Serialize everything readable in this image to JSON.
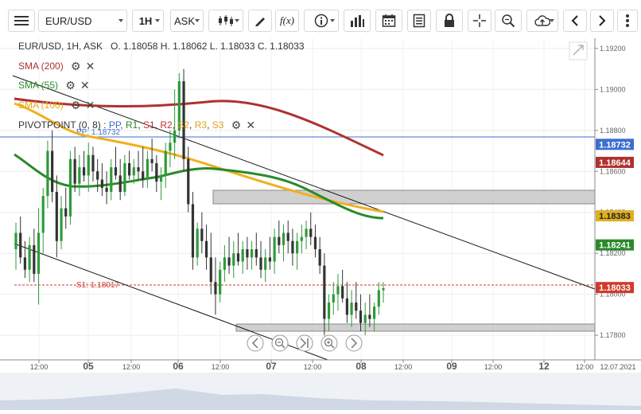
{
  "toolbar": {
    "symbol": "EUR/USD",
    "timeframe": "1H",
    "price_side": "ASK",
    "fx_label": "f(x)"
  },
  "info": {
    "header": "EUR/USD, 1H, ASK   O. 1.18058 H. 1.18062 L. 1.18033 C. 1.18033"
  },
  "indicators": {
    "sma200": {
      "label": "SMA (200)",
      "color": "#b03030"
    },
    "sma55": {
      "label": "SMA (55)",
      "color": "#2a8a2a"
    },
    "sma100": {
      "label": "SMA (100)",
      "color": "#f0b020"
    },
    "pivot": {
      "label": "PIVOTPOINT (0, 8)",
      "parts": [
        {
          "text": "PP",
          "color": "#3b6fd0"
        },
        {
          "text": "R1",
          "color": "#2a8a2a"
        },
        {
          "text": "S1",
          "color": "#c03030"
        },
        {
          "text": "R2",
          "color": "#c03030"
        },
        {
          "text": "S2",
          "color": "#e0a020"
        },
        {
          "text": "R3",
          "color": "#e0a020"
        },
        {
          "text": "S3",
          "color": "#e0a020"
        }
      ],
      "pp_label": "PP: 1.18732",
      "s1_label": "S1: 1.18017"
    }
  },
  "price_axis": {
    "ticks": [
      "1.19200",
      "1.19000",
      "1.18800",
      "1.18600",
      "1.18400",
      "1.18200",
      "1.18000",
      "1.17800"
    ],
    "badges": [
      {
        "value": "1.18732",
        "color": "#3b6fd0"
      },
      {
        "value": "1.18644",
        "color": "#b03030"
      },
      {
        "value": "1.18383",
        "color": "#e0b020"
      },
      {
        "value": "1.18241",
        "color": "#2a8a2a"
      },
      {
        "value": "1.18033",
        "color": "#d03a2a"
      }
    ]
  },
  "time_axis": {
    "labels": [
      "12:00",
      "05",
      "12:00",
      "06",
      "12:00",
      "07",
      "12:00",
      "08",
      "12:00",
      "09",
      "12:00",
      "12",
      "12:00",
      "12.07.2021"
    ]
  },
  "chart_data": {
    "type": "candlestick",
    "y_range": [
      1.1768,
      1.1925
    ],
    "candles": [
      [
        1.1822,
        1.1835,
        1.1812,
        1.183
      ],
      [
        1.183,
        1.1838,
        1.1815,
        1.1818
      ],
      [
        1.1818,
        1.1826,
        1.1808,
        1.1812
      ],
      [
        1.1812,
        1.1828,
        1.1806,
        1.1824
      ],
      [
        1.1824,
        1.1832,
        1.1806,
        1.181
      ],
      [
        1.181,
        1.1842,
        1.1795,
        1.183
      ],
      [
        1.183,
        1.1852,
        1.182,
        1.1848
      ],
      [
        1.1848,
        1.1875,
        1.1842,
        1.187
      ],
      [
        1.187,
        1.188,
        1.1845,
        1.185
      ],
      [
        1.185,
        1.1858,
        1.1818,
        1.1826
      ],
      [
        1.1826,
        1.1848,
        1.1822,
        1.1842
      ],
      [
        1.1842,
        1.1852,
        1.1832,
        1.1838
      ],
      [
        1.1838,
        1.187,
        1.1834,
        1.1866
      ],
      [
        1.1866,
        1.1872,
        1.185,
        1.1854
      ],
      [
        1.1854,
        1.1868,
        1.1848,
        1.1862
      ],
      [
        1.1862,
        1.187,
        1.1855,
        1.1858
      ],
      [
        1.1858,
        1.1874,
        1.185,
        1.1868
      ],
      [
        1.1868,
        1.1872,
        1.1855,
        1.186
      ],
      [
        1.186,
        1.1866,
        1.185,
        1.1856
      ],
      [
        1.1856,
        1.1864,
        1.1848,
        1.1852
      ],
      [
        1.1852,
        1.186,
        1.1844,
        1.185
      ],
      [
        1.185,
        1.1866,
        1.1846,
        1.1862
      ],
      [
        1.1862,
        1.1872,
        1.1856,
        1.1858
      ],
      [
        1.1858,
        1.1866,
        1.1846,
        1.185
      ],
      [
        1.185,
        1.1868,
        1.1848,
        1.1864
      ],
      [
        1.1864,
        1.187,
        1.1856,
        1.1858
      ],
      [
        1.1858,
        1.1866,
        1.1854,
        1.1862
      ],
      [
        1.1862,
        1.187,
        1.1856,
        1.186
      ],
      [
        1.186,
        1.1872,
        1.1852,
        1.1856
      ],
      [
        1.1856,
        1.187,
        1.1852,
        1.1866
      ],
      [
        1.1866,
        1.1876,
        1.186,
        1.1864
      ],
      [
        1.1864,
        1.1868,
        1.185,
        1.1855
      ],
      [
        1.1855,
        1.1862,
        1.1846,
        1.1858
      ],
      [
        1.1858,
        1.1874,
        1.1852,
        1.187
      ],
      [
        1.187,
        1.188,
        1.1862,
        1.1874
      ],
      [
        1.1874,
        1.19,
        1.1866,
        1.188
      ],
      [
        1.188,
        1.1908,
        1.1876,
        1.1904
      ],
      [
        1.1904,
        1.191,
        1.186,
        1.1866
      ],
      [
        1.1866,
        1.1872,
        1.184,
        1.1844
      ],
      [
        1.1844,
        1.185,
        1.1812,
        1.1818
      ],
      [
        1.1818,
        1.1835,
        1.1814,
        1.1832
      ],
      [
        1.1832,
        1.184,
        1.182,
        1.1826
      ],
      [
        1.1826,
        1.1834,
        1.1812,
        1.1818
      ],
      [
        1.1818,
        1.183,
        1.18,
        1.1806
      ],
      [
        1.1806,
        1.1818,
        1.179,
        1.18
      ],
      [
        1.18,
        1.1816,
        1.1796,
        1.1812
      ],
      [
        1.1812,
        1.1824,
        1.1806,
        1.1818
      ],
      [
        1.1818,
        1.1828,
        1.181,
        1.1814
      ],
      [
        1.1814,
        1.1826,
        1.1808,
        1.182
      ],
      [
        1.182,
        1.183,
        1.1814,
        1.1816
      ],
      [
        1.1816,
        1.1826,
        1.181,
        1.1822
      ],
      [
        1.1822,
        1.1828,
        1.1812,
        1.1818
      ],
      [
        1.1818,
        1.1826,
        1.1812,
        1.1822
      ],
      [
        1.1822,
        1.183,
        1.1814,
        1.1818
      ],
      [
        1.1818,
        1.1826,
        1.1808,
        1.1812
      ],
      [
        1.1812,
        1.1822,
        1.1806,
        1.1818
      ],
      [
        1.1818,
        1.1828,
        1.1812,
        1.1816
      ],
      [
        1.1816,
        1.1832,
        1.181,
        1.1828
      ],
      [
        1.1828,
        1.1836,
        1.182,
        1.1824
      ],
      [
        1.1824,
        1.1834,
        1.1816,
        1.183
      ],
      [
        1.183,
        1.1836,
        1.182,
        1.1826
      ],
      [
        1.1826,
        1.1832,
        1.1814,
        1.182
      ],
      [
        1.182,
        1.183,
        1.1812,
        1.1826
      ],
      [
        1.1826,
        1.1834,
        1.182,
        1.1828
      ],
      [
        1.1828,
        1.1836,
        1.1822,
        1.1832
      ],
      [
        1.1832,
        1.184,
        1.1824,
        1.1828
      ],
      [
        1.1828,
        1.1834,
        1.1818,
        1.1822
      ],
      [
        1.1822,
        1.1828,
        1.181,
        1.1814
      ],
      [
        1.1814,
        1.182,
        1.178,
        1.1788
      ],
      [
        1.1788,
        1.18,
        1.1782,
        1.1796
      ],
      [
        1.1796,
        1.1806,
        1.179,
        1.18
      ],
      [
        1.18,
        1.181,
        1.1792,
        1.1804
      ],
      [
        1.1804,
        1.1812,
        1.1796,
        1.1798
      ],
      [
        1.1798,
        1.1806,
        1.1786,
        1.179
      ],
      [
        1.179,
        1.1802,
        1.1784,
        1.1796
      ],
      [
        1.1796,
        1.1806,
        1.1788,
        1.1792
      ],
      [
        1.1792,
        1.18,
        1.1782,
        1.1786
      ],
      [
        1.1786,
        1.1796,
        1.178,
        1.179
      ],
      [
        1.179,
        1.18,
        1.1784,
        1.1788
      ],
      [
        1.1788,
        1.1796,
        1.1782,
        1.1794
      ],
      [
        1.1794,
        1.1806,
        1.179,
        1.1802
      ],
      [
        1.1802,
        1.1806,
        1.1796,
        1.1803
      ]
    ],
    "candle_colors": {
      "up": "#2e9a3a",
      "down": "#333333"
    }
  },
  "navigator": {
    "buttons": [
      "scroll-left",
      "zoom-out",
      "scroll-to-end",
      "zoom-in",
      "scroll-right"
    ]
  }
}
